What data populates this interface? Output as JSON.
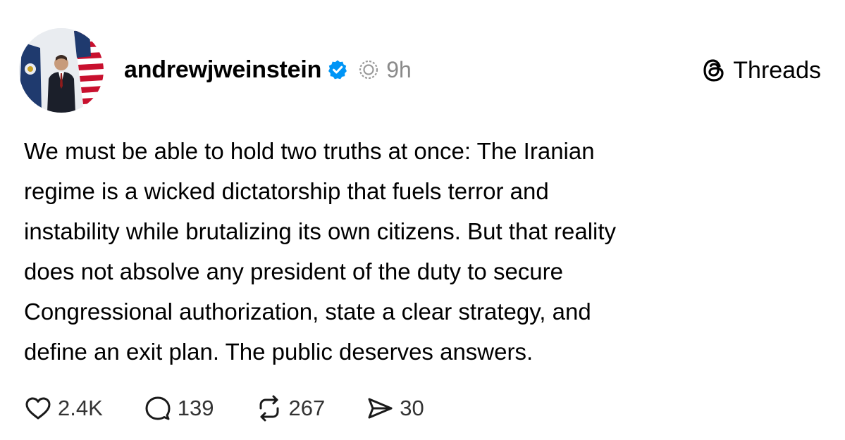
{
  "post": {
    "username": "andrewjweinstein",
    "time": "9h",
    "brand_label": "Threads",
    "body_lines": [
      "We must be able to hold two truths at once: The Iranian",
      "regime is a wicked dictatorship that fuels terror and",
      "instability while brutalizing its own citizens. But that reality",
      "does not absolve any president of the duty to secure",
      "Congressional authorization, state a clear strategy, and",
      "define an exit plan. The public deserves answers."
    ],
    "stats": {
      "likes": "2.4K",
      "replies": "139",
      "reposts": "267",
      "shares": "30"
    }
  },
  "icons": {
    "verified": "verified-badge-icon",
    "ring": "threads-ring-icon",
    "logo": "threads-logo-icon",
    "like": "heart-icon",
    "reply": "comment-icon",
    "repost": "repost-icon",
    "share": "send-icon"
  },
  "colors": {
    "verified_blue": "#0095f6",
    "text": "#000000",
    "muted": "#8a8a8a"
  }
}
